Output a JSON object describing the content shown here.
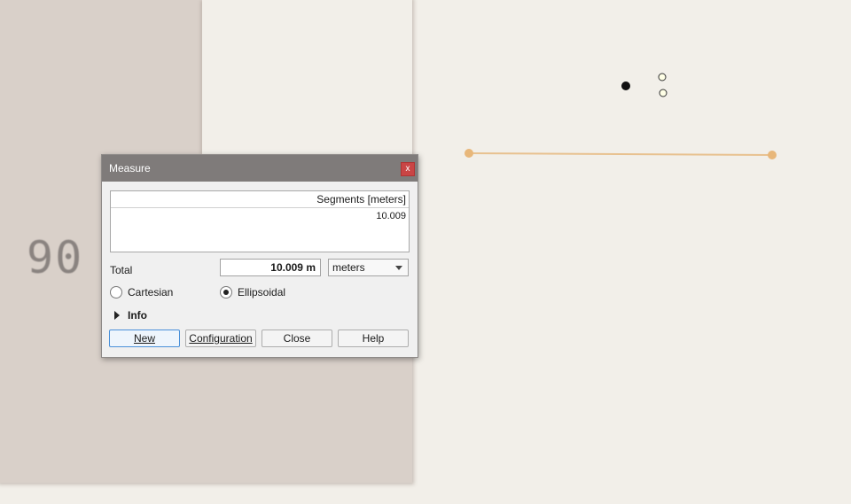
{
  "map": {
    "house_number": "90",
    "line_color": "#e8c18f",
    "vertex_color": "#e8b77a"
  },
  "dialog": {
    "title": "Measure",
    "close_glyph": "x",
    "segments_header": "Segments [meters]",
    "segments": [
      "10.009"
    ],
    "total_label": "Total",
    "total_value": "10.009 m",
    "unit_selected": "meters",
    "radio_cartesian": "Cartesian",
    "radio_ellipsoidal": "Ellipsoidal",
    "selected_mode": "Ellipsoidal",
    "info_label": "Info",
    "buttons": {
      "new_label": "New",
      "config_label": "Configuration",
      "close_label": "Close",
      "help_label": "Help"
    }
  }
}
